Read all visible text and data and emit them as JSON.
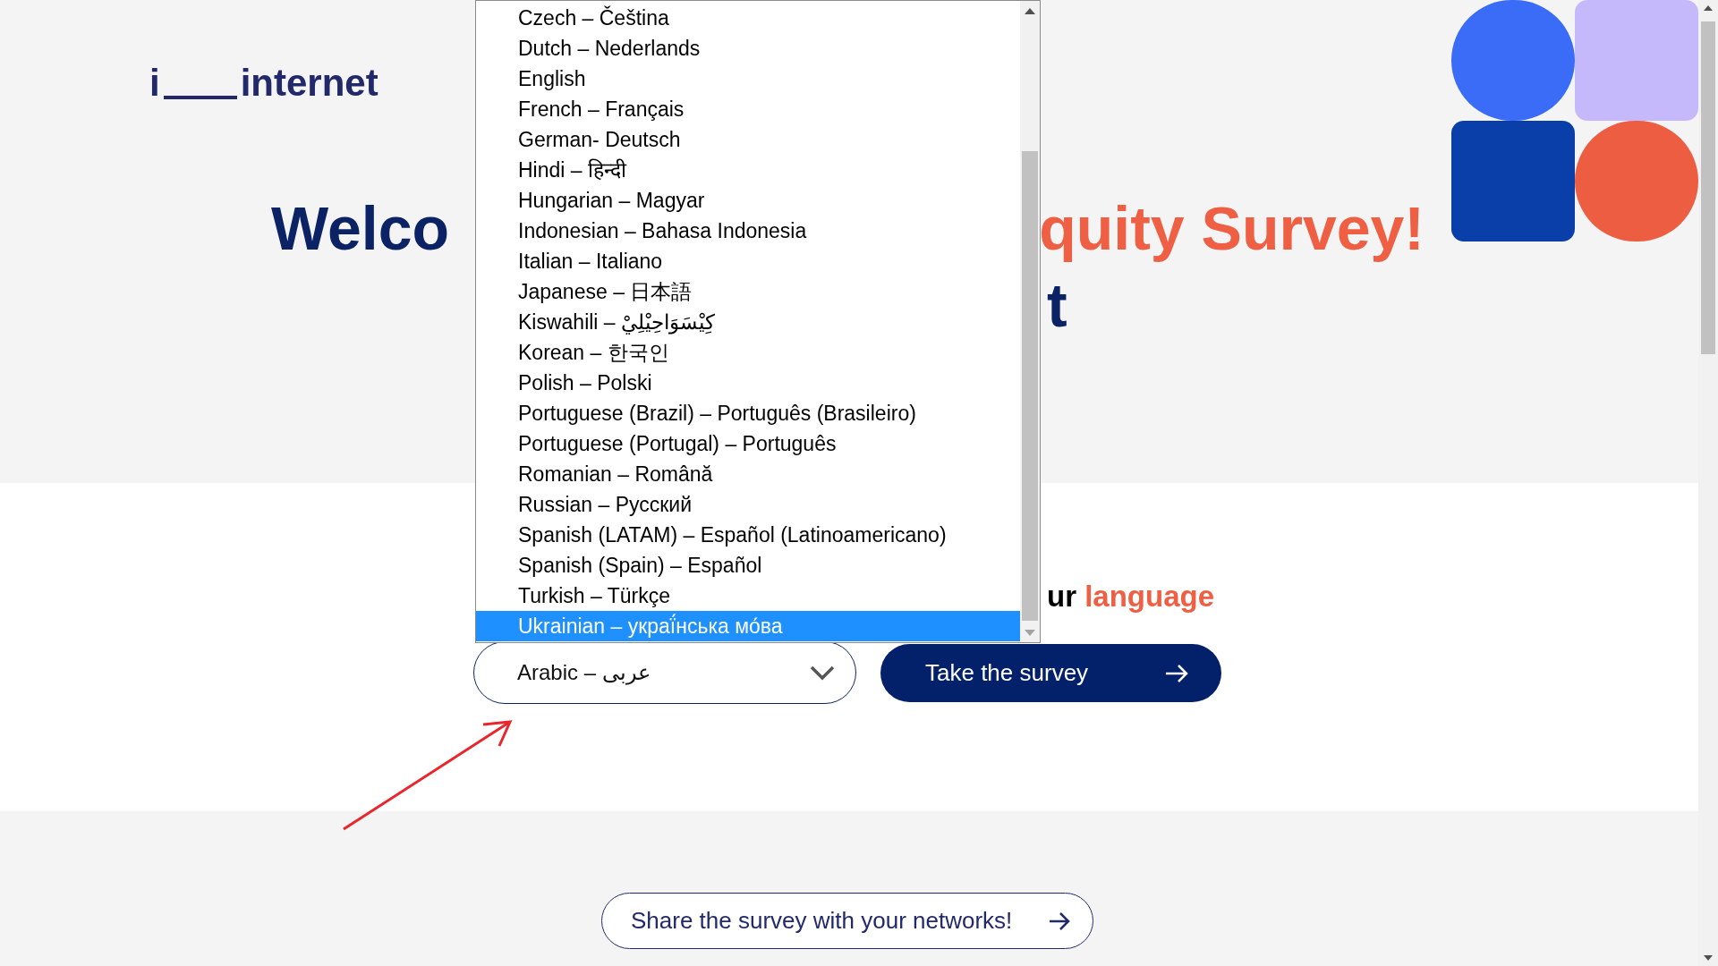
{
  "logo": {
    "prefix": "i",
    "name": "internet"
  },
  "heading": {
    "line_1_start": "Welco",
    "line_1_end": "quity Survey!",
    "line_2_end": "t"
  },
  "language_prompt": {
    "text": "ur",
    "accent": "language"
  },
  "language_select": {
    "value": "Arabic – عربى",
    "expanded": true
  },
  "language_options": [
    {
      "label": "Czech – Čeština",
      "selected": false
    },
    {
      "label": "Dutch – Nederlands",
      "selected": false
    },
    {
      "label": "English",
      "selected": false
    },
    {
      "label": "French – Français",
      "selected": false
    },
    {
      "label": "German- Deutsch",
      "selected": false
    },
    {
      "label": "Hindi – हिन्दी",
      "selected": false
    },
    {
      "label": "Hungarian – Magyar",
      "selected": false
    },
    {
      "label": "Indonesian – Bahasa Indonesia",
      "selected": false
    },
    {
      "label": "Italian – Italiano",
      "selected": false
    },
    {
      "label": "Japanese – 日本語",
      "selected": false
    },
    {
      "label": "Kiswahili – كِيْسَوَاحِيْلِيْ",
      "selected": false
    },
    {
      "label": "Korean – 한국인",
      "selected": false
    },
    {
      "label": "Polish – Polski",
      "selected": false
    },
    {
      "label": "Portuguese (Brazil) – Português (Brasileiro)",
      "selected": false
    },
    {
      "label": "Portuguese (Portugal) – Português",
      "selected": false
    },
    {
      "label": "Romanian – Română",
      "selected": false
    },
    {
      "label": "Russian – Русский",
      "selected": false
    },
    {
      "label": "Spanish (LATAM) – Español (Latinoamericano)",
      "selected": false
    },
    {
      "label": "Spanish (Spain) – Español",
      "selected": false
    },
    {
      "label": "Turkish – Türkçe",
      "selected": false
    },
    {
      "label": "Ukrainian – украї́нська мо́ва",
      "selected": true
    }
  ],
  "survey_button": {
    "label": "Take the survey"
  },
  "share_button": {
    "label": "Share the survey with your networks!"
  }
}
